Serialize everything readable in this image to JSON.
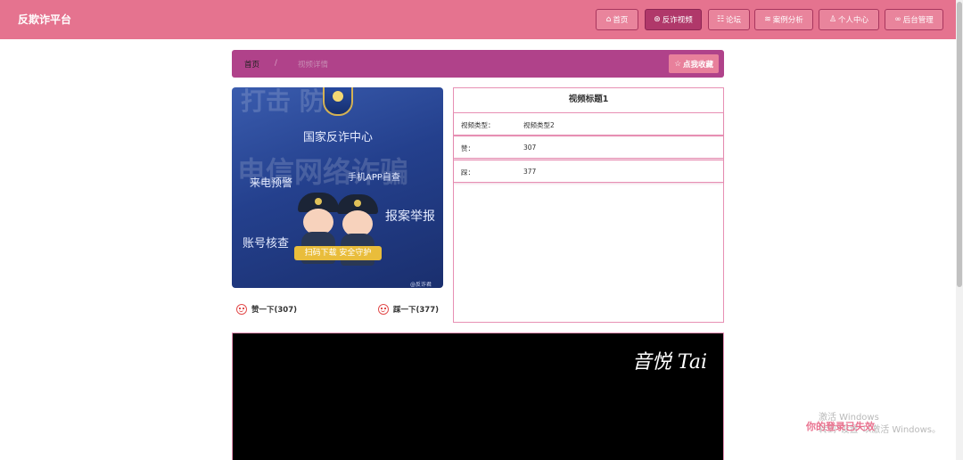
{
  "header": {
    "brand": "反欺诈平台",
    "nav": [
      {
        "label": "首页",
        "icon": "home-icon"
      },
      {
        "label": "反诈视频",
        "icon": "video-icon"
      },
      {
        "label": "论坛",
        "icon": "forum-icon"
      },
      {
        "label": "案例分析",
        "icon": "case-icon"
      },
      {
        "label": "个人中心",
        "icon": "user-icon"
      },
      {
        "label": "后台管理",
        "icon": "link-icon"
      }
    ]
  },
  "breadcrumb": {
    "home": "首页",
    "separator": "/",
    "current": "视频详情"
  },
  "favorite_label": "点我收藏",
  "cover": {
    "center_title": "国家反诈中心",
    "bg_text_top": "打击 防范",
    "bg_text_mid": "电信网络诈骗",
    "left_top": "来电预警",
    "right_top": "手机APP自查",
    "right_mid": "报案举报",
    "left_bottom": "账号核查",
    "ribbon": "扫码下载 安全守护",
    "watermark": "@反诈君"
  },
  "votes": {
    "like": "赞一下(307)",
    "dislike": "踩一下(377)"
  },
  "info": {
    "title": "视频标题1",
    "rows": [
      {
        "key": "视频类型：",
        "value": "视频类型2"
      },
      {
        "key": "赞：",
        "value": "307"
      },
      {
        "key": "踩：",
        "value": "377"
      }
    ]
  },
  "video": {
    "watermark": "音悦 Tai"
  },
  "system_overlay": {
    "line1": "激活 Windows",
    "line2": "转到\"设置\"以激活 Windows。",
    "line3": "你的登录已失效"
  },
  "colors": {
    "header": "#e5738f",
    "breadcrumb": "#b0428a",
    "active_nav": "#b0386a",
    "panel_border": "#e790b4"
  }
}
